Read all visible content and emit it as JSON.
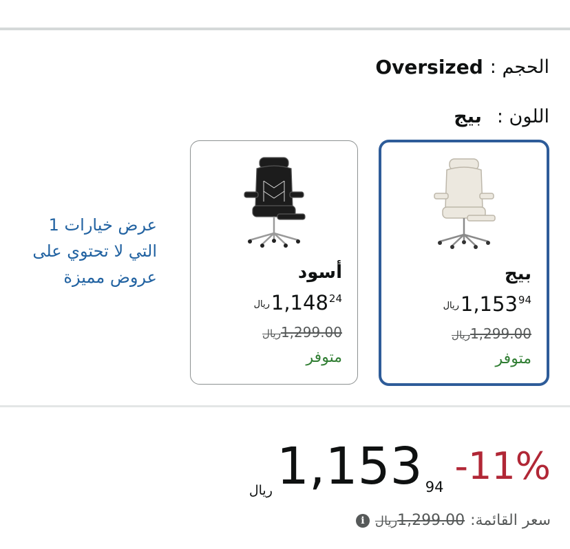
{
  "size": {
    "label": "الحجم :",
    "value": "Oversized"
  },
  "color": {
    "label": "اللون :",
    "value": "بيج"
  },
  "variants": [
    {
      "name": "بيج",
      "price_whole": "1,153",
      "price_fraction": "94",
      "currency": "ريال",
      "list_price": "1,299.00",
      "stock": "متوفر",
      "selected": true,
      "chair_color": "#ece8df"
    },
    {
      "name": "أسود",
      "price_whole": "1,148",
      "price_fraction": "24",
      "currency": "ريال",
      "list_price": "1,299.00",
      "stock": "متوفر",
      "selected": false,
      "chair_color": "#1c1c1c"
    }
  ],
  "more_options": "عرض خيارات 1 التي لا تحتوي على عروض مميزة",
  "price": {
    "discount": "-11%",
    "whole": "1,153",
    "fraction": "94",
    "currency": "ريال",
    "list_label": "سعر القائمة:",
    "list_value": "1,299.00",
    "info_icon": "i"
  },
  "colors": {
    "accent": "#2e5c99",
    "link": "#2162a1",
    "discount": "#b12736",
    "in_stock": "#2f7d32"
  }
}
